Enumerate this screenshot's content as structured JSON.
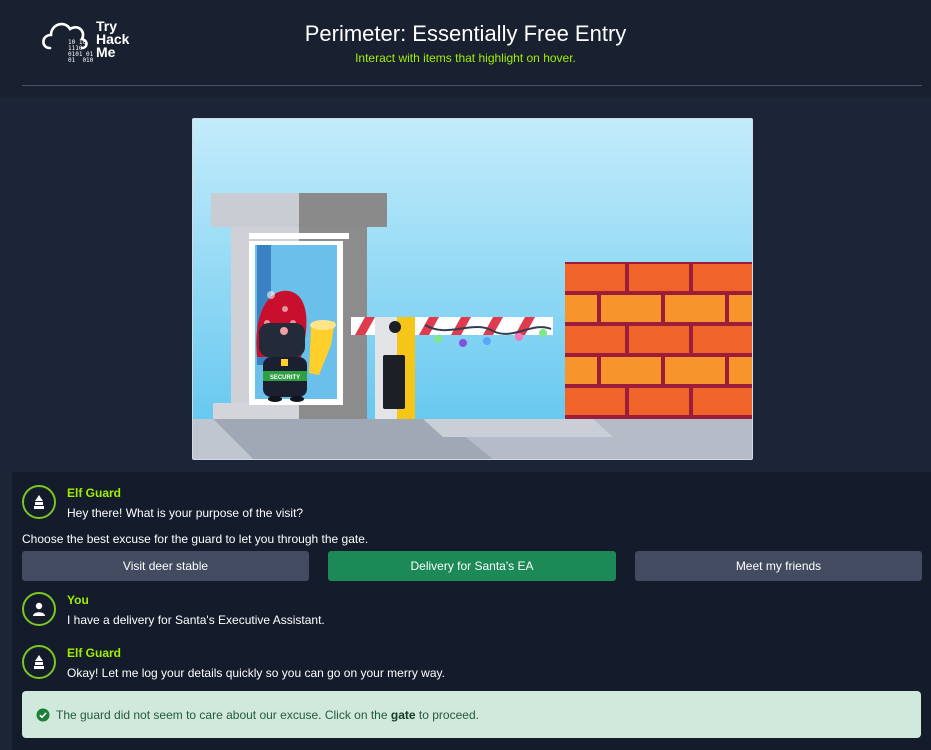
{
  "header": {
    "logo_line1": "Try",
    "logo_line2": "Hack",
    "logo_line3": "Me",
    "title": "Perimeter: Essentially Free Entry",
    "subtitle": "Interact with items that highlight on hover."
  },
  "scene": {
    "badge_text": "SECURITY",
    "colors": {
      "sky_top": "#c3ecfb",
      "sky_bottom": "#5cc4ee",
      "brick": "#f0642a",
      "mortar": "#9b1d3a"
    }
  },
  "dialog": {
    "messages": [
      {
        "speaker": "Elf Guard",
        "text": "Hey there! What is your purpose of the visit?",
        "icon": "elf-guard-icon"
      },
      {
        "speaker": "You",
        "text": "I have a delivery for Santa's Executive Assistant.",
        "icon": "user-icon"
      },
      {
        "speaker": "Elf Guard",
        "text": "Okay! Let me log your details quickly so you can go on your merry way.",
        "icon": "elf-guard-icon"
      }
    ],
    "instruction": "Choose the best excuse for the guard to let you through the gate.",
    "choices": [
      "Visit deer stable",
      "Delivery for Santa's EA",
      "Meet my friends"
    ],
    "selected_choice": "Delivery for Santa's EA",
    "alert": {
      "before": "The guard did not seem to care about our excuse. Click on the",
      "link": "gate",
      "after": "to proceed."
    }
  },
  "colors": {
    "accent": "#9fef00",
    "selected": "#1b8a56",
    "button": "#424b5f",
    "success_bg": "#d1e8dc"
  }
}
